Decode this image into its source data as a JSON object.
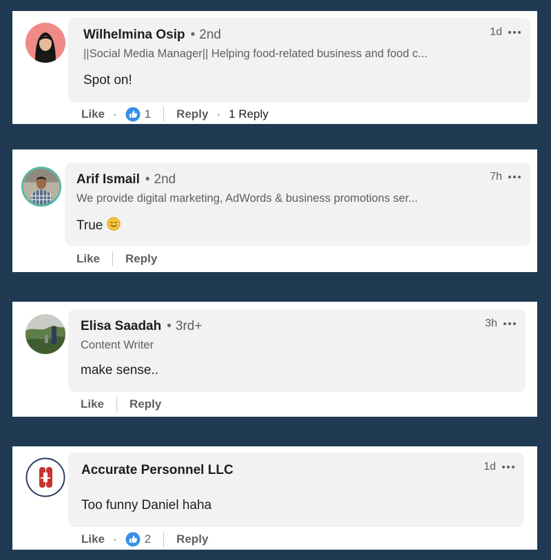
{
  "comments": [
    {
      "name": "Wilhelmina Osip",
      "separator": "•",
      "degree": "2nd",
      "time": "1d",
      "headline": "||Social Media Manager|| Helping food-related business and food c...",
      "text": "Spot on!",
      "like_label": "Like",
      "reaction_count": "1",
      "reply_label": "Reply",
      "replies_label": "1 Reply"
    },
    {
      "name": "Arif Ismail",
      "separator": "•",
      "degree": "2nd",
      "time": "7h",
      "headline": "We provide digital marketing, AdWords & business promotions ser...",
      "text": "True",
      "like_label": "Like",
      "reply_label": "Reply"
    },
    {
      "name": "Elisa Saadah",
      "separator": "•",
      "degree": "3rd+",
      "time": "3h",
      "headline": "Content Writer",
      "text": "make sense..",
      "like_label": "Like",
      "reply_label": "Reply"
    },
    {
      "name": "Accurate Personnel LLC",
      "time": "1d",
      "text": "Too funny Daniel haha",
      "like_label": "Like",
      "reaction_count": "2",
      "reply_label": "Reply"
    }
  ],
  "action_separator": "·",
  "icons": {
    "more": "more-options-icon",
    "reaction": "like-reaction-icon",
    "emoji": "smiling-face-emoji"
  },
  "colors": {
    "background": "#1f3a52",
    "card": "#ffffff",
    "bubble": "#f2f2f2",
    "like_blue": "#378fe9",
    "company_red": "#c8342f"
  }
}
